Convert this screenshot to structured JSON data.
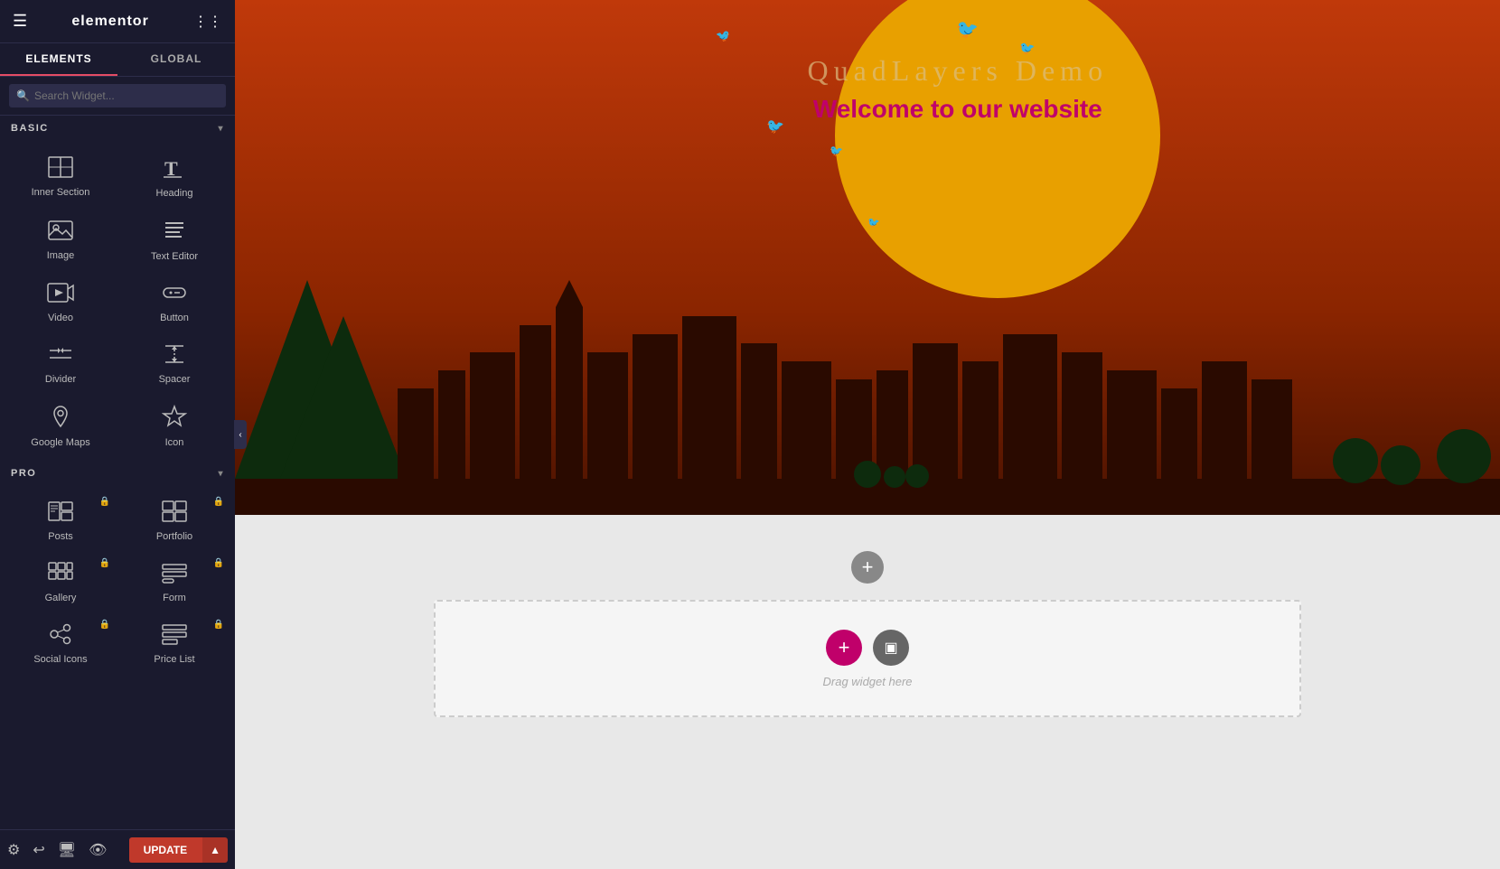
{
  "app": {
    "title": "elementor",
    "hamburger_icon": "☰",
    "grid_icon": "⋮⋮"
  },
  "tabs": [
    {
      "id": "elements",
      "label": "ELEMENTS",
      "active": true
    },
    {
      "id": "global",
      "label": "GLOBAL",
      "active": false
    }
  ],
  "search": {
    "placeholder": "Search Widget..."
  },
  "sections": [
    {
      "id": "basic",
      "label": "BASIC",
      "expanded": true,
      "widgets": [
        {
          "id": "inner-section",
          "label": "Inner Section",
          "icon": "inner-section-icon",
          "locked": false
        },
        {
          "id": "heading",
          "label": "Heading",
          "icon": "heading-icon",
          "locked": false
        },
        {
          "id": "image",
          "label": "Image",
          "icon": "image-icon",
          "locked": false
        },
        {
          "id": "text-editor",
          "label": "Text Editor",
          "icon": "text-editor-icon",
          "locked": false
        },
        {
          "id": "video",
          "label": "Video",
          "icon": "video-icon",
          "locked": false
        },
        {
          "id": "button",
          "label": "Button",
          "icon": "button-icon",
          "locked": false
        },
        {
          "id": "divider",
          "label": "Divider",
          "icon": "divider-icon",
          "locked": false
        },
        {
          "id": "spacer",
          "label": "Spacer",
          "icon": "spacer-icon",
          "locked": false
        },
        {
          "id": "google-maps",
          "label": "Google Maps",
          "icon": "maps-icon",
          "locked": false
        },
        {
          "id": "icon",
          "label": "Icon",
          "icon": "icon-icon",
          "locked": false
        }
      ]
    },
    {
      "id": "pro",
      "label": "PRO",
      "expanded": true,
      "widgets": [
        {
          "id": "posts",
          "label": "Posts",
          "icon": "posts-icon",
          "locked": true
        },
        {
          "id": "portfolio",
          "label": "Portfolio",
          "icon": "portfolio-icon",
          "locked": true
        },
        {
          "id": "gallery",
          "label": "Gallery",
          "icon": "gallery-icon",
          "locked": true
        },
        {
          "id": "form",
          "label": "Form",
          "icon": "form-icon",
          "locked": true
        },
        {
          "id": "social-icons",
          "label": "Social Icons",
          "icon": "social-icon",
          "locked": true
        },
        {
          "id": "price-list",
          "label": "Price List",
          "icon": "price-list-icon",
          "locked": true
        }
      ]
    }
  ],
  "footer": {
    "icons": [
      "settings-icon",
      "history-icon",
      "responsive-icon",
      "eye-icon"
    ],
    "update_label": "UPDATE",
    "update_arrow": "▲"
  },
  "canvas": {
    "hero_title": "QuadLayers Demo",
    "hero_subtitle": "Welcome to our website",
    "add_section_hint": "+",
    "drag_hint": "Drag widget here"
  }
}
